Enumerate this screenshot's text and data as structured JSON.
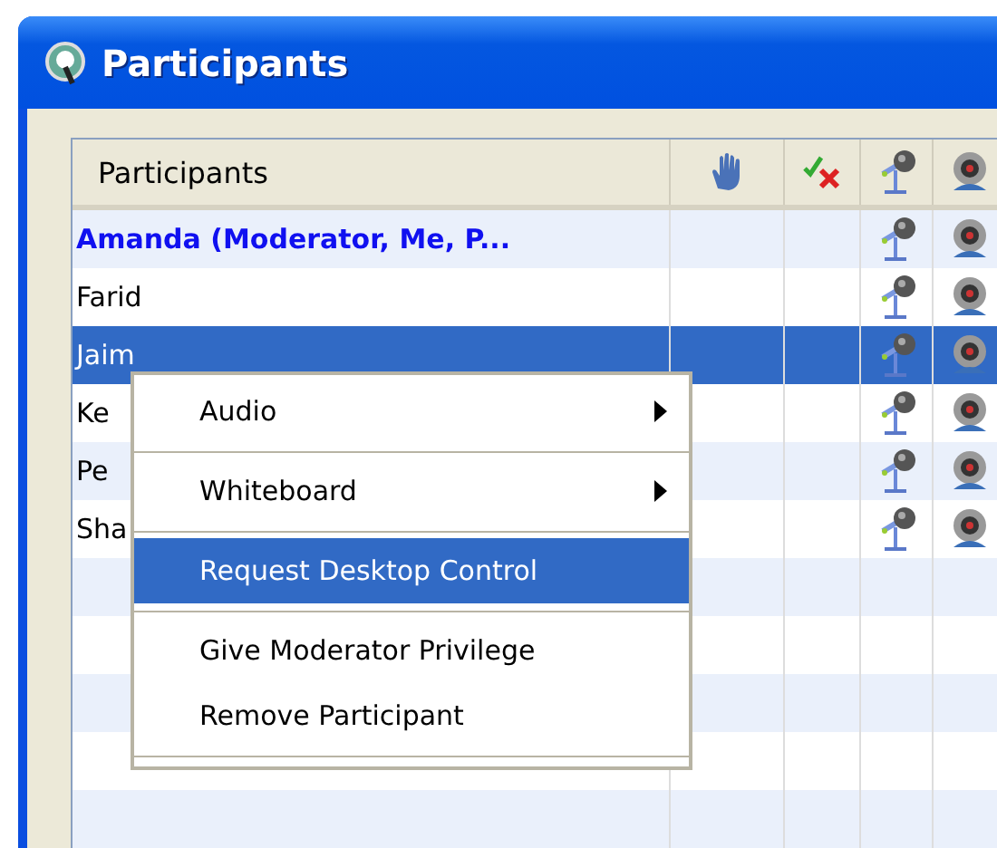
{
  "window": {
    "title": "Participants"
  },
  "table": {
    "columns": [
      {
        "label": "Participants"
      }
    ],
    "rows": [
      {
        "name": "Amanda (Moderator, Me, P...",
        "kind": "moderator",
        "selected": false
      },
      {
        "name": "Farid",
        "kind": "participant",
        "selected": false
      },
      {
        "name": "Jaim",
        "kind": "participant",
        "selected": true
      },
      {
        "name": "Ke",
        "kind": "participant",
        "selected": false
      },
      {
        "name": "Pe",
        "kind": "participant",
        "selected": false
      },
      {
        "name": "Sha",
        "kind": "participant",
        "selected": false
      }
    ]
  },
  "context_menu": {
    "items": [
      {
        "label": "Audio",
        "submenu": true,
        "selected": false,
        "separator_after": true
      },
      {
        "label": "Whiteboard",
        "submenu": true,
        "selected": false,
        "separator_after": true
      },
      {
        "label": "Request Desktop Control",
        "submenu": false,
        "selected": true,
        "separator_after": true
      },
      {
        "label": "Give Moderator Privilege",
        "submenu": false,
        "selected": false,
        "separator_after": false
      },
      {
        "label": "Remove Participant",
        "submenu": false,
        "selected": false,
        "separator_after": true
      }
    ]
  }
}
